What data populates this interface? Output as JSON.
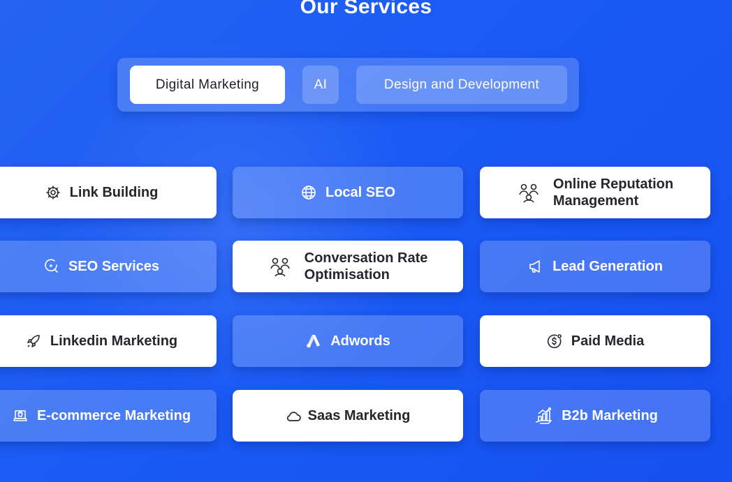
{
  "heading": "Our Services",
  "tabs": [
    {
      "label": "Digital Marketing",
      "active": true
    },
    {
      "label": "AI",
      "active": false
    },
    {
      "label": "Design and Development",
      "active": false
    }
  ],
  "services": [
    {
      "label": "Link Building",
      "icon": "network-gear-icon",
      "style": "light"
    },
    {
      "label": "Local SEO",
      "icon": "globe-icon",
      "style": "dark"
    },
    {
      "label": "Online Reputation Management",
      "line1": "Online Reputation",
      "line2": "Management",
      "icon": "people-group-icon",
      "style": "light"
    },
    {
      "label": "SEO Services",
      "icon": "search-refresh-icon",
      "style": "dark"
    },
    {
      "label": "Conversation Rate Optimisation",
      "line1": "Conversation Rate",
      "line2": "Optimisation",
      "icon": "people-group-icon",
      "style": "light"
    },
    {
      "label": "Lead Generation",
      "icon": "megaphone-icon",
      "style": "dark"
    },
    {
      "label": "Linkedin Marketing",
      "icon": "rocket-icon",
      "style": "light"
    },
    {
      "label": "Adwords",
      "icon": "adwords-logo-icon",
      "style": "dark"
    },
    {
      "label": "Paid Media",
      "icon": "dollar-coin-icon",
      "style": "light"
    },
    {
      "label": "E-commerce Marketing",
      "icon": "laptop-shop-icon",
      "style": "dark"
    },
    {
      "label": "Saas Marketing",
      "icon": "cloud-icon",
      "style": "light"
    },
    {
      "label": "B2b Marketing",
      "icon": "growth-chart-icon",
      "style": "dark"
    }
  ],
  "colors": {
    "background": "#1d5bf4",
    "card_light": "#ffffff",
    "card_dark_overlay": "rgba(255,255,255,0.2)",
    "text_dark": "#26262f",
    "text_light": "#ffffff"
  }
}
